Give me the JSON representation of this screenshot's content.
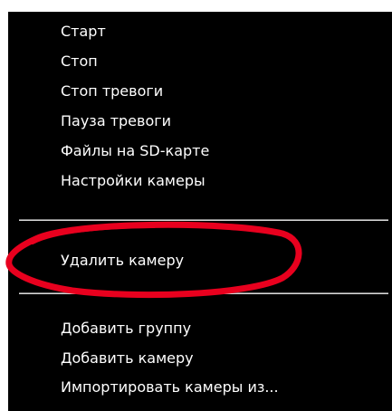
{
  "context_menu": {
    "items": [
      {
        "label": "Старт"
      },
      {
        "label": "Стоп"
      },
      {
        "label": "Стоп тревоги"
      },
      {
        "label": "Пауза тревоги"
      },
      {
        "label": "Файлы на SD-карте"
      },
      {
        "label": "Настройки камеры"
      },
      {
        "label": "Удалить камеру"
      },
      {
        "label": "Добавить группу"
      },
      {
        "label": "Добавить камеру"
      },
      {
        "label": "Импортировать камеры из..."
      }
    ]
  },
  "colors": {
    "menu_background": "#000000",
    "menu_text": "#ffffff",
    "highlight_ellipse": "#e8001e"
  }
}
